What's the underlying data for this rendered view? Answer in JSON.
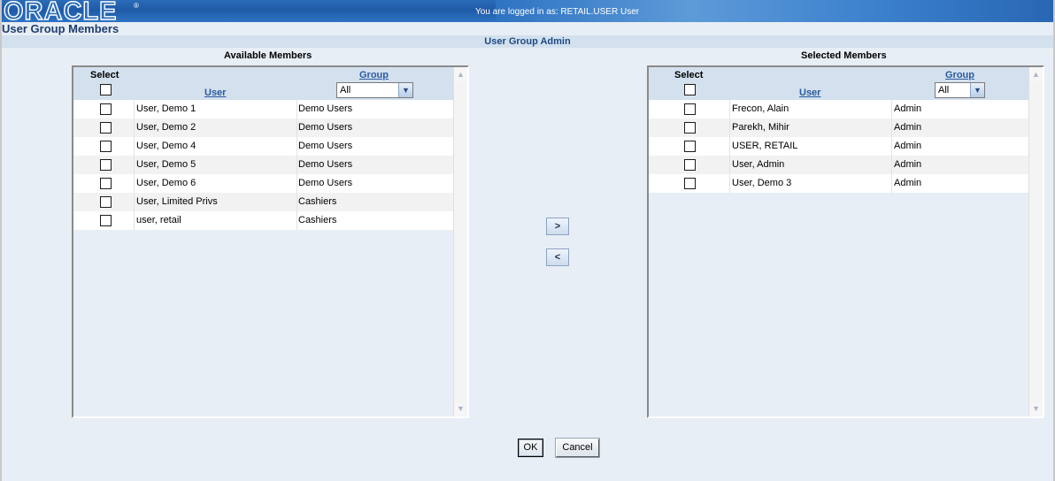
{
  "header": {
    "logo": "ORACLE",
    "logged_in_text": "You are logged in as: RETAIL.USER User"
  },
  "page": {
    "title": "User Group Members",
    "section": "User Group Admin"
  },
  "available": {
    "title": "Available Members",
    "select_label": "Select",
    "user_label": "User",
    "group_label": "Group",
    "group_filter": "All",
    "rows": [
      {
        "user": "User, Demo 1",
        "group": "Demo Users"
      },
      {
        "user": "User, Demo 2",
        "group": "Demo Users"
      },
      {
        "user": "User, Demo 4",
        "group": "Demo Users"
      },
      {
        "user": "User, Demo 5",
        "group": "Demo Users"
      },
      {
        "user": "User, Demo 6",
        "group": "Demo Users"
      },
      {
        "user": "User, Limited Privs",
        "group": "Cashiers"
      },
      {
        "user": "user, retail",
        "group": "Cashiers"
      }
    ]
  },
  "selected": {
    "title": "Selected Members",
    "select_label": "Select",
    "user_label": "User",
    "group_label": "Group",
    "group_filter": "All",
    "rows": [
      {
        "user": "Frecon, Alain",
        "group": "Admin"
      },
      {
        "user": "Parekh, Mihir",
        "group": "Admin"
      },
      {
        "user": "USER, RETAIL",
        "group": "Admin"
      },
      {
        "user": "User, Admin",
        "group": "Admin"
      },
      {
        "user": "User, Demo 3",
        "group": "Admin"
      }
    ]
  },
  "controls": {
    "add_label": ">",
    "remove_label": "<",
    "ok_label": "OK",
    "cancel_label": "Cancel"
  }
}
